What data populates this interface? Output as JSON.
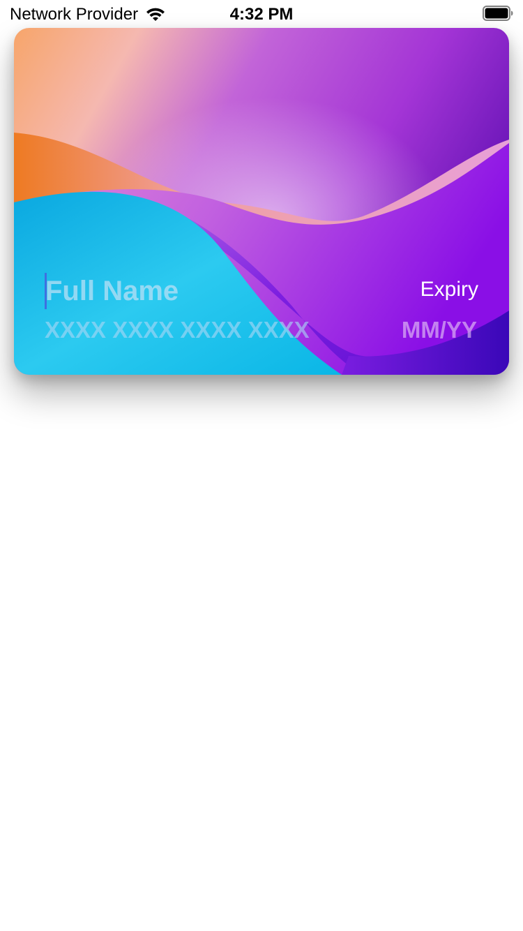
{
  "status_bar": {
    "carrier": "Network Provider",
    "time": "4:32 PM",
    "wifi_icon": "wifi-icon",
    "battery_icon": "battery-icon"
  },
  "card": {
    "name_placeholder": "Full Name",
    "number_placeholder": "XXXX XXXX XXXX XXXX",
    "expiry_label": "Expiry",
    "expiry_placeholder": "MM/YY"
  },
  "colors": {
    "caret": "#3f6fe0",
    "orange": "#ee7a22",
    "cyan": "#1bbbe8",
    "purple": "#8a1ae0",
    "deep_purple": "#3a07b8"
  }
}
